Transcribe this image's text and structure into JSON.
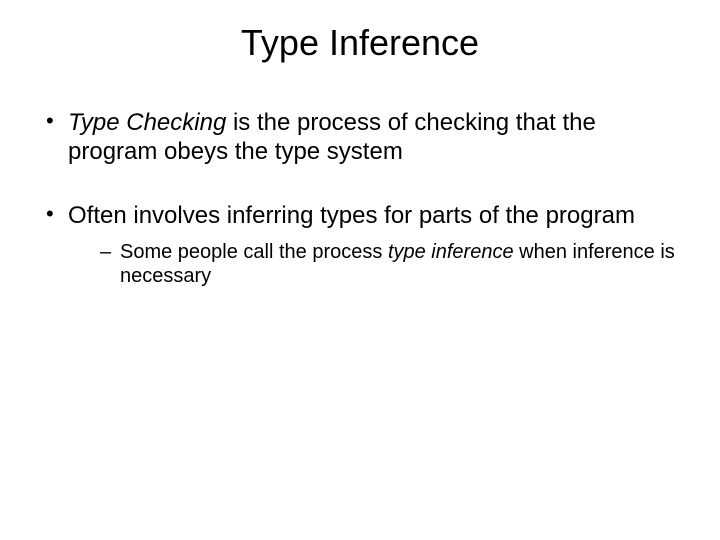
{
  "title": "Type Inference",
  "bullets": {
    "b1": {
      "term": "Type Checking",
      "rest": " is the process of checking that the program obeys the type system"
    },
    "b2": {
      "text": "Often involves inferring types for parts of the program",
      "sub": {
        "pre": "Some people call the process ",
        "term": "type inference",
        "post": " when inference is necessary"
      }
    }
  }
}
